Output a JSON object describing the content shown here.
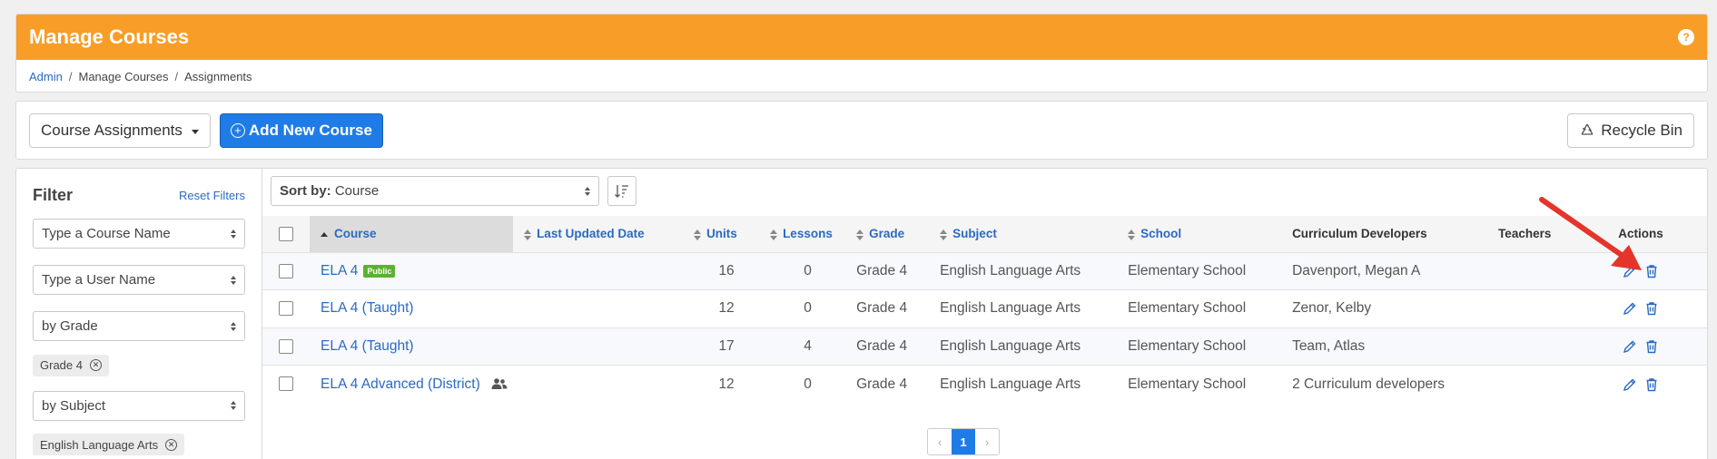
{
  "header": {
    "title": "Manage Courses",
    "help_icon": "?"
  },
  "breadcrumb": {
    "root": "Admin",
    "items": [
      "Manage Courses",
      "Assignments"
    ],
    "separator": "/"
  },
  "toolbar": {
    "view_select": "Course Assignments",
    "add_button": "Add New Course",
    "recycle_button": "Recycle Bin"
  },
  "filter": {
    "title": "Filter",
    "reset": "Reset Filters",
    "course_name_placeholder": "Type a Course Name",
    "user_name_placeholder": "Type a User Name",
    "grade_select": "by Grade",
    "grade_chip": "Grade 4",
    "subject_select": "by Subject",
    "subject_chip": "English Language Arts"
  },
  "sort": {
    "label": "Sort by:",
    "value": "Course"
  },
  "table": {
    "headers": {
      "course": "Course",
      "updated": "Last Updated Date",
      "units": "Units",
      "lessons": "Lessons",
      "grade": "Grade",
      "subject": "Subject",
      "school": "School",
      "developers": "Curriculum Developers",
      "teachers": "Teachers",
      "actions": "Actions"
    },
    "rows": [
      {
        "course": "ELA 4",
        "badge": "Public",
        "units": "16",
        "lessons": "0",
        "grade": "Grade 4",
        "subject": "English Language Arts",
        "school": "Elementary School",
        "developers": "Davenport, Megan A"
      },
      {
        "course": "ELA 4 (Taught)",
        "badge": "",
        "units": "12",
        "lessons": "0",
        "grade": "Grade 4",
        "subject": "English Language Arts",
        "school": "Elementary School",
        "developers": "Zenor, Kelby"
      },
      {
        "course": "ELA 4 (Taught)",
        "badge": "",
        "units": "17",
        "lessons": "4",
        "grade": "Grade 4",
        "subject": "English Language Arts",
        "school": "Elementary School",
        "developers": "Team, Atlas"
      },
      {
        "course": "ELA 4 Advanced (District)",
        "badge": "",
        "units": "12",
        "lessons": "0",
        "grade": "Grade 4",
        "subject": "English Language Arts",
        "school": "Elementary School",
        "developers": "2 Curriculum developers"
      }
    ]
  },
  "pagination": {
    "current": "1"
  },
  "colors": {
    "header": "#f89d27",
    "primary": "#1f7ce6",
    "link": "#2a6ac3",
    "badge": "#5cb230",
    "arrow": "#e5342b"
  }
}
